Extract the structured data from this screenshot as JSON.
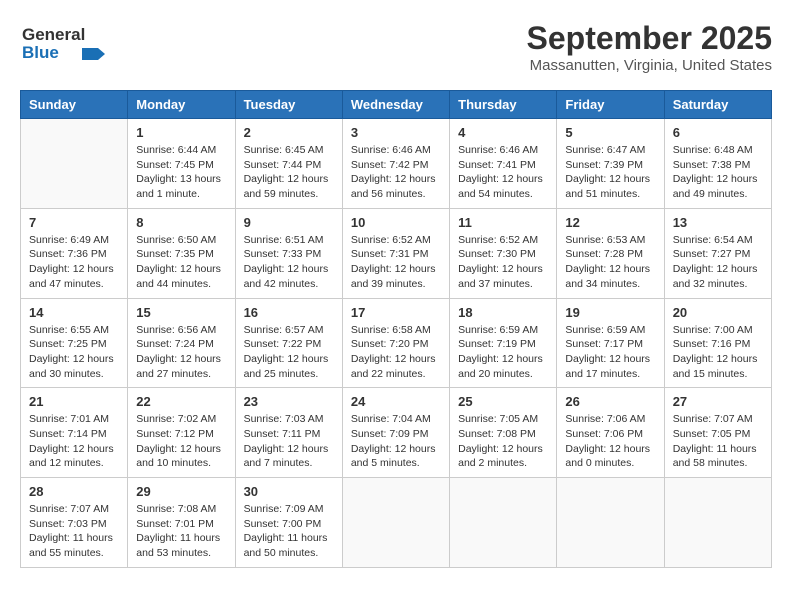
{
  "header": {
    "logo_line1": "General",
    "logo_line2": "Blue",
    "title": "September 2025",
    "subtitle": "Massanutten, Virginia, United States"
  },
  "calendar": {
    "days_of_week": [
      "Sunday",
      "Monday",
      "Tuesday",
      "Wednesday",
      "Thursday",
      "Friday",
      "Saturday"
    ],
    "weeks": [
      [
        {
          "day": "",
          "info": ""
        },
        {
          "day": "1",
          "info": "Sunrise: 6:44 AM\nSunset: 7:45 PM\nDaylight: 13 hours\nand 1 minute."
        },
        {
          "day": "2",
          "info": "Sunrise: 6:45 AM\nSunset: 7:44 PM\nDaylight: 12 hours\nand 59 minutes."
        },
        {
          "day": "3",
          "info": "Sunrise: 6:46 AM\nSunset: 7:42 PM\nDaylight: 12 hours\nand 56 minutes."
        },
        {
          "day": "4",
          "info": "Sunrise: 6:46 AM\nSunset: 7:41 PM\nDaylight: 12 hours\nand 54 minutes."
        },
        {
          "day": "5",
          "info": "Sunrise: 6:47 AM\nSunset: 7:39 PM\nDaylight: 12 hours\nand 51 minutes."
        },
        {
          "day": "6",
          "info": "Sunrise: 6:48 AM\nSunset: 7:38 PM\nDaylight: 12 hours\nand 49 minutes."
        }
      ],
      [
        {
          "day": "7",
          "info": "Sunrise: 6:49 AM\nSunset: 7:36 PM\nDaylight: 12 hours\nand 47 minutes."
        },
        {
          "day": "8",
          "info": "Sunrise: 6:50 AM\nSunset: 7:35 PM\nDaylight: 12 hours\nand 44 minutes."
        },
        {
          "day": "9",
          "info": "Sunrise: 6:51 AM\nSunset: 7:33 PM\nDaylight: 12 hours\nand 42 minutes."
        },
        {
          "day": "10",
          "info": "Sunrise: 6:52 AM\nSunset: 7:31 PM\nDaylight: 12 hours\nand 39 minutes."
        },
        {
          "day": "11",
          "info": "Sunrise: 6:52 AM\nSunset: 7:30 PM\nDaylight: 12 hours\nand 37 minutes."
        },
        {
          "day": "12",
          "info": "Sunrise: 6:53 AM\nSunset: 7:28 PM\nDaylight: 12 hours\nand 34 minutes."
        },
        {
          "day": "13",
          "info": "Sunrise: 6:54 AM\nSunset: 7:27 PM\nDaylight: 12 hours\nand 32 minutes."
        }
      ],
      [
        {
          "day": "14",
          "info": "Sunrise: 6:55 AM\nSunset: 7:25 PM\nDaylight: 12 hours\nand 30 minutes."
        },
        {
          "day": "15",
          "info": "Sunrise: 6:56 AM\nSunset: 7:24 PM\nDaylight: 12 hours\nand 27 minutes."
        },
        {
          "day": "16",
          "info": "Sunrise: 6:57 AM\nSunset: 7:22 PM\nDaylight: 12 hours\nand 25 minutes."
        },
        {
          "day": "17",
          "info": "Sunrise: 6:58 AM\nSunset: 7:20 PM\nDaylight: 12 hours\nand 22 minutes."
        },
        {
          "day": "18",
          "info": "Sunrise: 6:59 AM\nSunset: 7:19 PM\nDaylight: 12 hours\nand 20 minutes."
        },
        {
          "day": "19",
          "info": "Sunrise: 6:59 AM\nSunset: 7:17 PM\nDaylight: 12 hours\nand 17 minutes."
        },
        {
          "day": "20",
          "info": "Sunrise: 7:00 AM\nSunset: 7:16 PM\nDaylight: 12 hours\nand 15 minutes."
        }
      ],
      [
        {
          "day": "21",
          "info": "Sunrise: 7:01 AM\nSunset: 7:14 PM\nDaylight: 12 hours\nand 12 minutes."
        },
        {
          "day": "22",
          "info": "Sunrise: 7:02 AM\nSunset: 7:12 PM\nDaylight: 12 hours\nand 10 minutes."
        },
        {
          "day": "23",
          "info": "Sunrise: 7:03 AM\nSunset: 7:11 PM\nDaylight: 12 hours\nand 7 minutes."
        },
        {
          "day": "24",
          "info": "Sunrise: 7:04 AM\nSunset: 7:09 PM\nDaylight: 12 hours\nand 5 minutes."
        },
        {
          "day": "25",
          "info": "Sunrise: 7:05 AM\nSunset: 7:08 PM\nDaylight: 12 hours\nand 2 minutes."
        },
        {
          "day": "26",
          "info": "Sunrise: 7:06 AM\nSunset: 7:06 PM\nDaylight: 12 hours\nand 0 minutes."
        },
        {
          "day": "27",
          "info": "Sunrise: 7:07 AM\nSunset: 7:05 PM\nDaylight: 11 hours\nand 58 minutes."
        }
      ],
      [
        {
          "day": "28",
          "info": "Sunrise: 7:07 AM\nSunset: 7:03 PM\nDaylight: 11 hours\nand 55 minutes."
        },
        {
          "day": "29",
          "info": "Sunrise: 7:08 AM\nSunset: 7:01 PM\nDaylight: 11 hours\nand 53 minutes."
        },
        {
          "day": "30",
          "info": "Sunrise: 7:09 AM\nSunset: 7:00 PM\nDaylight: 11 hours\nand 50 minutes."
        },
        {
          "day": "",
          "info": ""
        },
        {
          "day": "",
          "info": ""
        },
        {
          "day": "",
          "info": ""
        },
        {
          "day": "",
          "info": ""
        }
      ]
    ]
  }
}
